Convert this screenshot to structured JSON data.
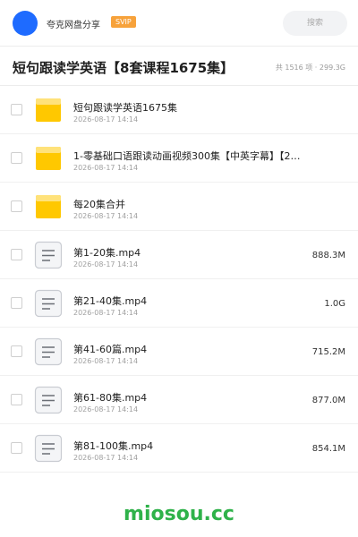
{
  "header": {
    "share_name": "夸克网盘分享",
    "badge": "SVIP",
    "search_label": "搜索"
  },
  "folder": {
    "title": "短句跟读学英语【8套课程1675集】",
    "meta": "共 1516 项 · 299.3G"
  },
  "items": [
    {
      "name": "短句跟读学英语1675集",
      "date": "2026-08-17 14:14",
      "size": "",
      "type": "folder"
    },
    {
      "name": "1-零基础口语跟读动画视频300集【中英字幕】【2…",
      "date": "2026-08-17 14:14",
      "size": "",
      "type": "folder"
    },
    {
      "name": "每20集合并",
      "date": "2026-08-17 14:14",
      "size": "",
      "type": "folder"
    },
    {
      "name": "第1-20集.mp4",
      "date": "2026-08-17 14:14",
      "size": "888.3M",
      "type": "file"
    },
    {
      "name": "第21-40集.mp4",
      "date": "2026-08-17 14:14",
      "size": "1.0G",
      "type": "file"
    },
    {
      "name": "第41-60篇.mp4",
      "date": "2026-08-17 14:14",
      "size": "715.2M",
      "type": "file"
    },
    {
      "name": "第61-80集.mp4",
      "date": "2026-08-17 14:14",
      "size": "877.0M",
      "type": "file"
    },
    {
      "name": "第81-100集.mp4",
      "date": "2026-08-17 14:14",
      "size": "854.1M",
      "type": "file"
    }
  ],
  "watermark": "miosou.cc",
  "colors": {
    "accent": "#1e6bff",
    "badge": "#f7a23b",
    "folder": "#ffc800",
    "watermark": "#2fb24a"
  }
}
